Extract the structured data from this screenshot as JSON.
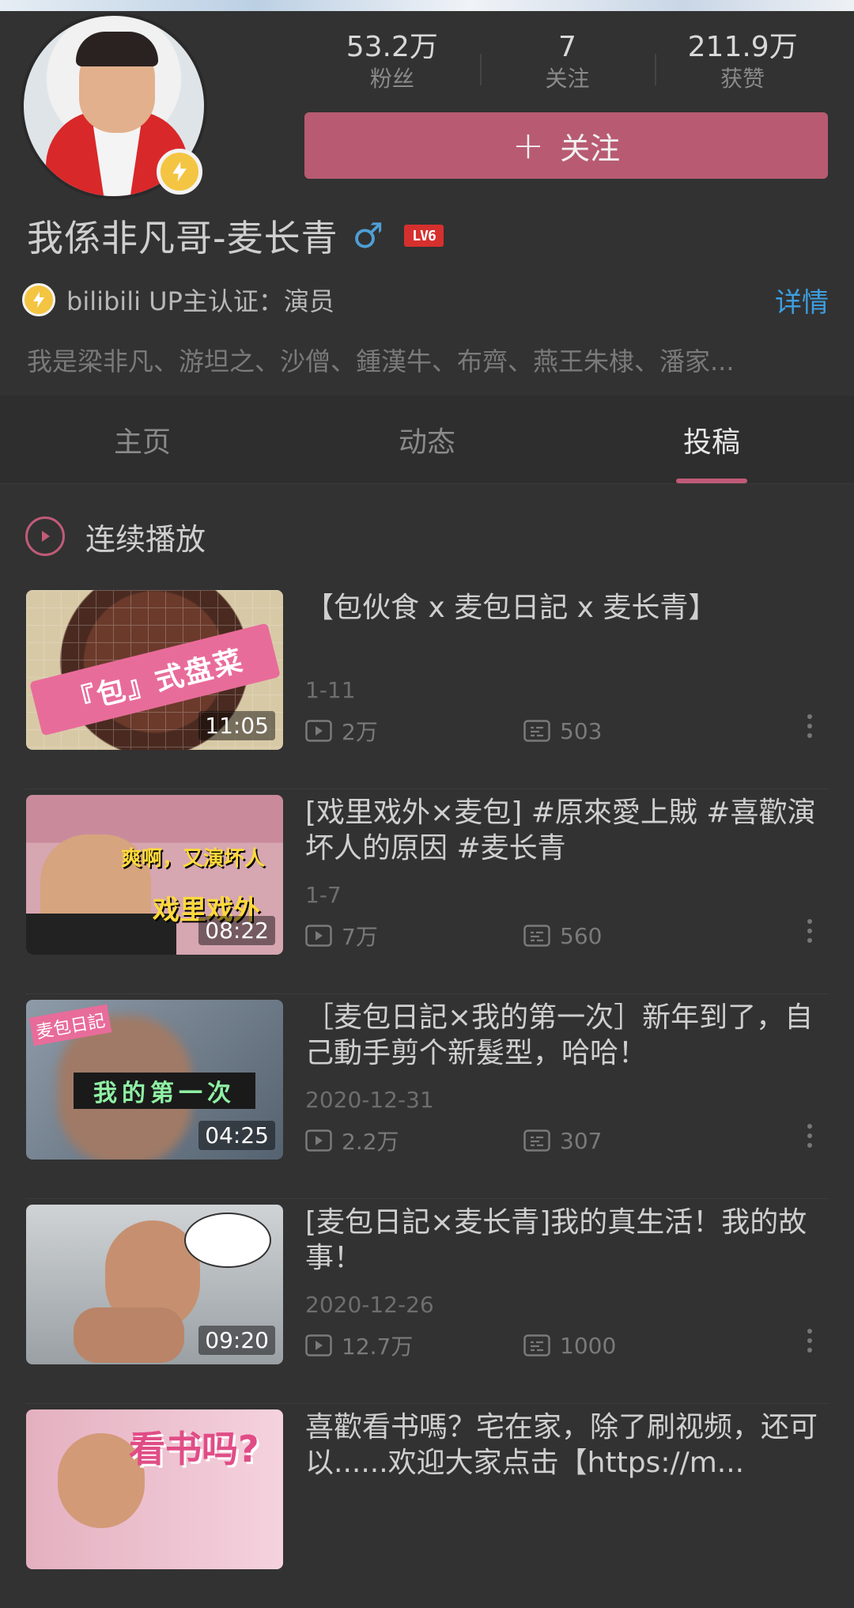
{
  "profile": {
    "name": "我係非凡哥-麦长青",
    "gender_symbol": "♂",
    "level_badge": "LV6",
    "certification": "bilibili UP主认证：演员",
    "detail_link": "详情",
    "bio": "我是梁非凡、游坦之、沙僧、鍾漢牛、布齊、燕王朱棣、潘家...",
    "stats": [
      {
        "value": "53.2万",
        "label": "粉丝"
      },
      {
        "value": "7",
        "label": "关注"
      },
      {
        "value": "211.9万",
        "label": "获赞"
      }
    ],
    "follow_button": "关注"
  },
  "tabs": [
    {
      "label": "主页",
      "active": false
    },
    {
      "label": "动态",
      "active": false
    },
    {
      "label": "投稿",
      "active": true
    }
  ],
  "play_all_label": "连续播放",
  "videos": [
    {
      "title": "【包伙食 x 麦包日記 x 麦长青】",
      "date": "1-11",
      "views": "2万",
      "danmaku": "503",
      "duration": "11:05",
      "thumb_caption": "『包』式盘菜"
    },
    {
      "title": "[戏里戏外×麦包] #原來愛上賊 #喜歡演坏人的原因 #麦长青",
      "date": "1-7",
      "views": "7万",
      "danmaku": "560",
      "duration": "08:22",
      "thumb_caption_1": "爽啊，又演坏人",
      "thumb_caption_2": "戏里戏外"
    },
    {
      "title": "［麦包日記×我的第一次］新年到了，自己動手剪个新髮型，哈哈！",
      "date": "2020-12-31",
      "views": "2.2万",
      "danmaku": "307",
      "duration": "04:25",
      "thumb_caption": "我的第一次",
      "thumb_tag": "麦包日記"
    },
    {
      "title": "[麦包日記×麦长青]我的真生活！我的故事！",
      "date": "2020-12-26",
      "views": "12.7万",
      "danmaku": "1000",
      "duration": "09:20"
    },
    {
      "title": "喜歡看书嗎？宅在家，除了刷视频，还可以......欢迎大家点击【https://m...",
      "date": "",
      "views": "",
      "danmaku": "",
      "duration": "",
      "thumb_caption": "看书吗?"
    }
  ],
  "colors": {
    "background": "#323232",
    "accent_pink": "#c05b78",
    "follow_button": "#b85b72",
    "link_blue": "#3d9ee0",
    "badge_yellow": "#f4c542"
  }
}
